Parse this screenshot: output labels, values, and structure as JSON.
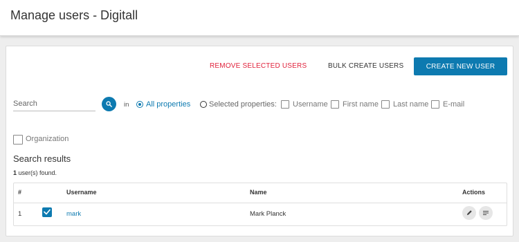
{
  "header": {
    "title": "Manage users - Digitall"
  },
  "toolbar": {
    "remove_label": "REMOVE SELECTED USERS",
    "bulk_label": "BULK CREATE USERS",
    "create_label": "CREATE NEW USER",
    "remove_color": "#e0213b",
    "accent_color": "#0d7ab0"
  },
  "search": {
    "placeholder": "Search",
    "value": "",
    "icon": "search-icon",
    "in_label": "in",
    "all_properties_label": "All properties",
    "all_properties_selected": true,
    "selected_properties_label": "Selected properties:",
    "selected_properties_selected": false,
    "properties": [
      {
        "label": "Username",
        "checked": false
      },
      {
        "label": "First name",
        "checked": false
      },
      {
        "label": "Last name",
        "checked": false
      },
      {
        "label": "E-mail",
        "checked": false
      }
    ],
    "organization": {
      "label": "Organization",
      "checked": false
    }
  },
  "results": {
    "title": "Search results",
    "count": "1",
    "count_suffix": " user(s) found.",
    "columns": {
      "index": "#",
      "username": "Username",
      "name": "Name",
      "actions": "Actions"
    },
    "rows": [
      {
        "index": "1",
        "checked": true,
        "username": "mark",
        "name": "Mark Planck",
        "actions": [
          "edit-icon",
          "details-icon"
        ]
      }
    ]
  }
}
